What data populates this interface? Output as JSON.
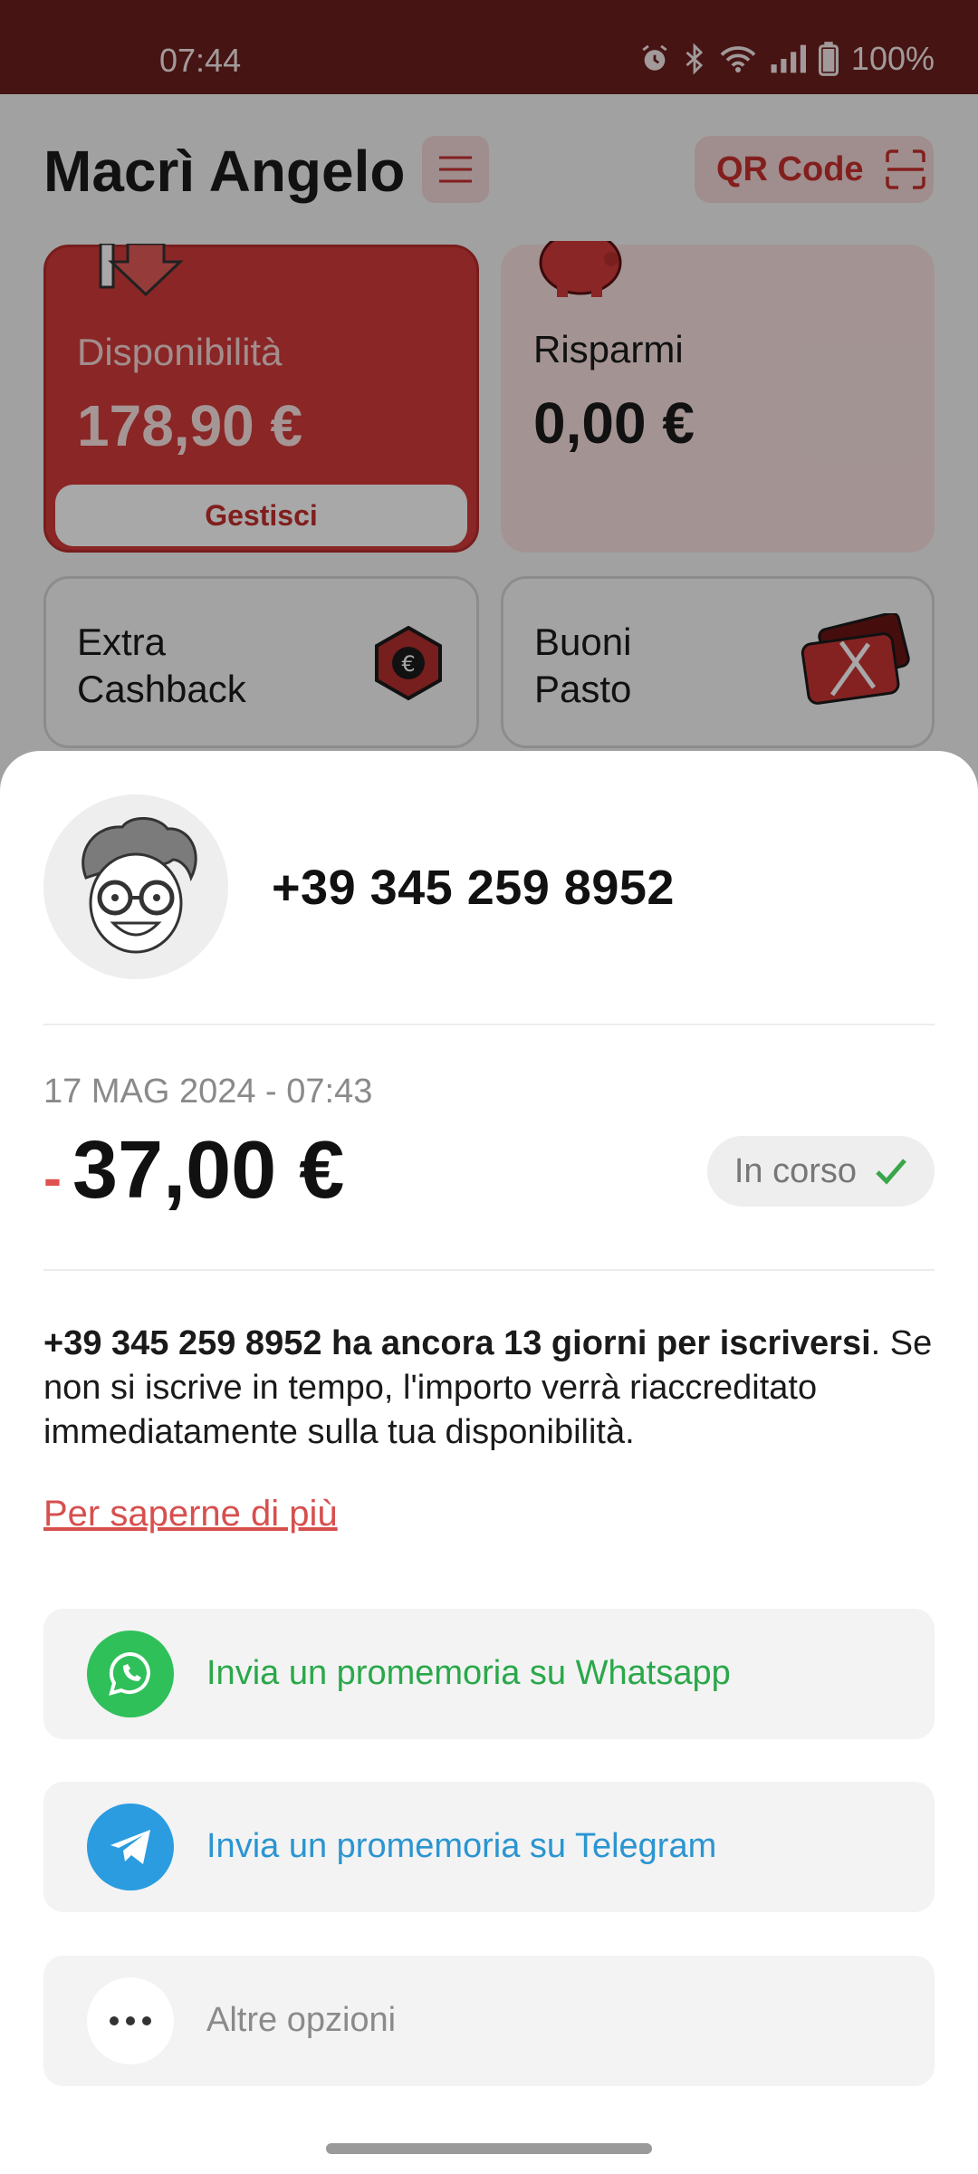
{
  "status_bar": {
    "time": "07:44",
    "battery": "100%"
  },
  "header": {
    "user_name": "Macrì Angelo",
    "qr_label": "QR Code"
  },
  "cards": {
    "availability": {
      "label": "Disponibilità",
      "amount": "178,90 €",
      "manage_label": "Gestisci"
    },
    "savings": {
      "label": "Risparmi",
      "amount": "0,00 €"
    },
    "cashback": {
      "label": "Extra\nCashback"
    },
    "meal": {
      "label": "Buoni\nPasto"
    }
  },
  "sheet": {
    "contact": "+39 345 259 8952",
    "date": "17 MAG 2024 - 07:43",
    "sign": "-",
    "amount": "37,00 €",
    "status": "In corso",
    "info_bold": "+39 345 259 8952 ha ancora 13 giorni per iscriversi",
    "info_rest": ". Se non si iscrive in tempo, l'importo verrà riaccreditato immediatamente sulla tua disponibilità.",
    "learn_more": "Per saperne di più",
    "actions": [
      {
        "label": "Invia un promemoria su Whatsapp"
      },
      {
        "label": "Invia un promemoria su Telegram"
      },
      {
        "label": "Altre opzioni"
      }
    ]
  },
  "colors": {
    "brand": "#d23b3a",
    "status_bar": "#6b1f1e",
    "whatsapp": "#2fc05a",
    "telegram": "#2b9ce0",
    "success": "#3aa64a"
  }
}
